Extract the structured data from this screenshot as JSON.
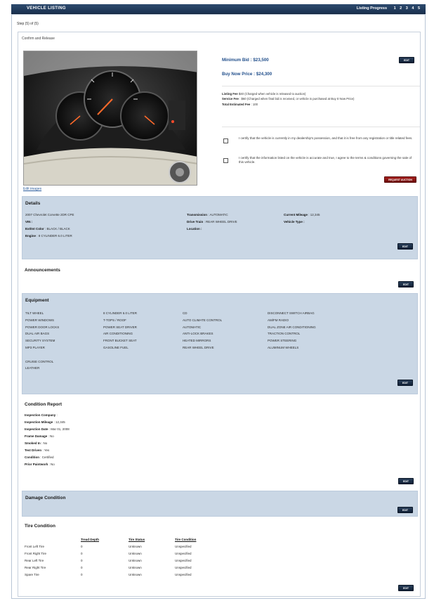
{
  "header": {
    "title": "VEHICLE LISTING",
    "progress_label": "Listing Progress",
    "steps": [
      "1",
      "2",
      "3",
      "4",
      "5"
    ]
  },
  "step_label": "Step (5) of (5)",
  "confirm_label": "Confirm and Release",
  "edit_images": "Edit images",
  "pricing": {
    "min_bid": "Minimum Bid : $23,500",
    "buy_now": "Buy Now Price : $24,300",
    "edit_label": "EDIT"
  },
  "fees": {
    "listing_label": "Listing Fee",
    "listing_text": "$40 (Charged when vehicle is released to auction)",
    "service_label": "Service Fee",
    "service_text": ": $60 (Charged when final bid is received, or vehicle is purchased at Buy It Now Price)",
    "total_label": "Total Estimated Fee",
    "total_text": ": 100"
  },
  "certify": {
    "check1": "I certify that the vehicle is currently in my dealership's possession, and that it is free from any registration or title related fees.",
    "check2": "I certify that the information listed on the vehicle is accurate and true, I agree to the terms & conditions governing the sale of this vehicle.",
    "request_label": "REQUEST AUCTION"
  },
  "details": {
    "title": "Details",
    "vehicle": "2007 Chevrolet Corvette 2DR CPE",
    "vin_label": "VIN :",
    "ext_int_label": "Ext/Int Color",
    "ext_int_value": ": BLACK / BLACK",
    "engine_label": "Engine",
    "engine_value": ": 8 CYLINDER 6.0 LITER",
    "transmission_label": "Transmission",
    "transmission_value": ": AUTOMATIC",
    "drive_label": "Drive Train",
    "drive_value": ": REAR WHEEL DRIVE",
    "location_label": "Location :",
    "mileage_label": "Current Mileage",
    "mileage_value": ": 12,345",
    "type_label": "Vehicle Type :"
  },
  "announcements": {
    "title": "Announcements"
  },
  "equipment": {
    "title": "Equipment",
    "col1": [
      "TILT WHEEL",
      "POWER WINDOWS",
      "POWER DOOR LOCKS",
      "DUAL AIR BAGS",
      "SECURITY SYSTEM",
      "MP3 PLAYER",
      "",
      "CRUISE CONTROL",
      "LEATHER"
    ],
    "col2": [
      "8 CYLINDER 6.0 LITER",
      "T-TOPS / ROOF",
      "POWER SEAT DRIVER",
      "AIR CONDITIONING",
      "FRONT BUCKET SEAT",
      "GASOLINE FUEL"
    ],
    "col3": [
      "CD",
      "AUTO CLIMATE CONTROL",
      "AUTOMATIC",
      "ANTI-LOCK BRAKES",
      "HEATED MIRRORS",
      "REAR WHEEL DRIVE"
    ],
    "col4": [
      "DISCONNECT SWITCH AIRBAG",
      "AM/FM RADIO",
      "DUAL ZONE AIR CONDITIONING",
      "TRACTION CONTROL",
      "POWER STEERING",
      "ALUMINUM WHEELS"
    ]
  },
  "condition": {
    "title": "Condition Report",
    "items": [
      {
        "label": "Inspection Company",
        "value": ":"
      },
      {
        "label": "Inspection Mileage",
        "value": ": 12,345"
      },
      {
        "label": "Inspection Date",
        "value": ": Mar 01, 2008"
      },
      {
        "label": "Frame Damage",
        "value": ": No"
      },
      {
        "label": "Smoked In",
        "value": ": No"
      },
      {
        "label": "Test Driven",
        "value": ": Yes"
      },
      {
        "label": "Condition",
        "value": ": Certified"
      },
      {
        "label": "Prior Paintwork",
        "value": ": No"
      }
    ]
  },
  "damage": {
    "title": "Damage Condition"
  },
  "tire": {
    "title": "Tire Condition",
    "headers": [
      "",
      "Tread Depth",
      "Tire Status",
      "Tire Condition"
    ],
    "rows": [
      [
        "Front Left Tire",
        "0",
        "Unknown",
        "Unspecified"
      ],
      [
        "Front Right Tire",
        "0",
        "Unknown",
        "Unspecified"
      ],
      [
        "Rear Left Tire",
        "0",
        "Unknown",
        "Unspecified"
      ],
      [
        "Rear Right Tire",
        "0",
        "Unknown",
        "Unspecified"
      ],
      [
        "Spare Tire",
        "0",
        "Unknown",
        "Unspecified"
      ]
    ]
  },
  "edit_label": "EDIT",
  "colors": {
    "header_bg": "#1b3250",
    "section_bg": "#cad7e5",
    "price_text": "#1f4d8a",
    "request_btn": "#a8201d"
  }
}
